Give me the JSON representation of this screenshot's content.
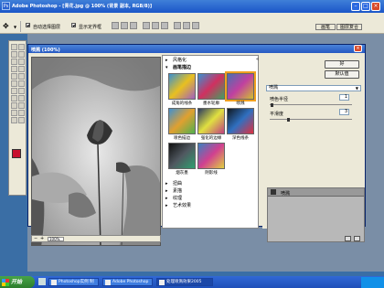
{
  "app": {
    "title": "Adobe Photoshop - [青花.jpg @ 100% (背景 副本, RGB/8)]",
    "icon_label": "Ps"
  },
  "optbar": {
    "auto_select_label": "自动选择图层",
    "show_bounds_label": "显示定界框",
    "palette_well_btn": "画笔",
    "layer_comps_btn": "图层复合"
  },
  "dialog": {
    "title": "喷溅 (100%)",
    "zoom": "100%",
    "categories": {
      "artistic": "风格化",
      "brush": "画笔描边",
      "distort": "扭曲",
      "sketch": "素描",
      "texture": "纹理",
      "stylize": "艺术效果"
    },
    "filters": [
      {
        "label": "成角的线条"
      },
      {
        "label": "墨水轮廓"
      },
      {
        "label": "喷溅"
      },
      {
        "label": "喷色描边"
      },
      {
        "label": "强化的边缘"
      },
      {
        "label": "深色线条"
      },
      {
        "label": "烟灰墨"
      },
      {
        "label": "阴影线"
      }
    ],
    "ok": "好",
    "default": "默认值",
    "filter_select": "喷溅",
    "params": {
      "radius_label": "喷色半径",
      "radius_value": "1",
      "smooth_label": "平滑度",
      "smooth_value": "3"
    },
    "layer_name": "喷溅"
  },
  "taskbar": {
    "start": "开始",
    "tasks": [
      "Photoshop实例 制",
      "Adobe Photoshop",
      "处理喷溅效果2005"
    ]
  }
}
